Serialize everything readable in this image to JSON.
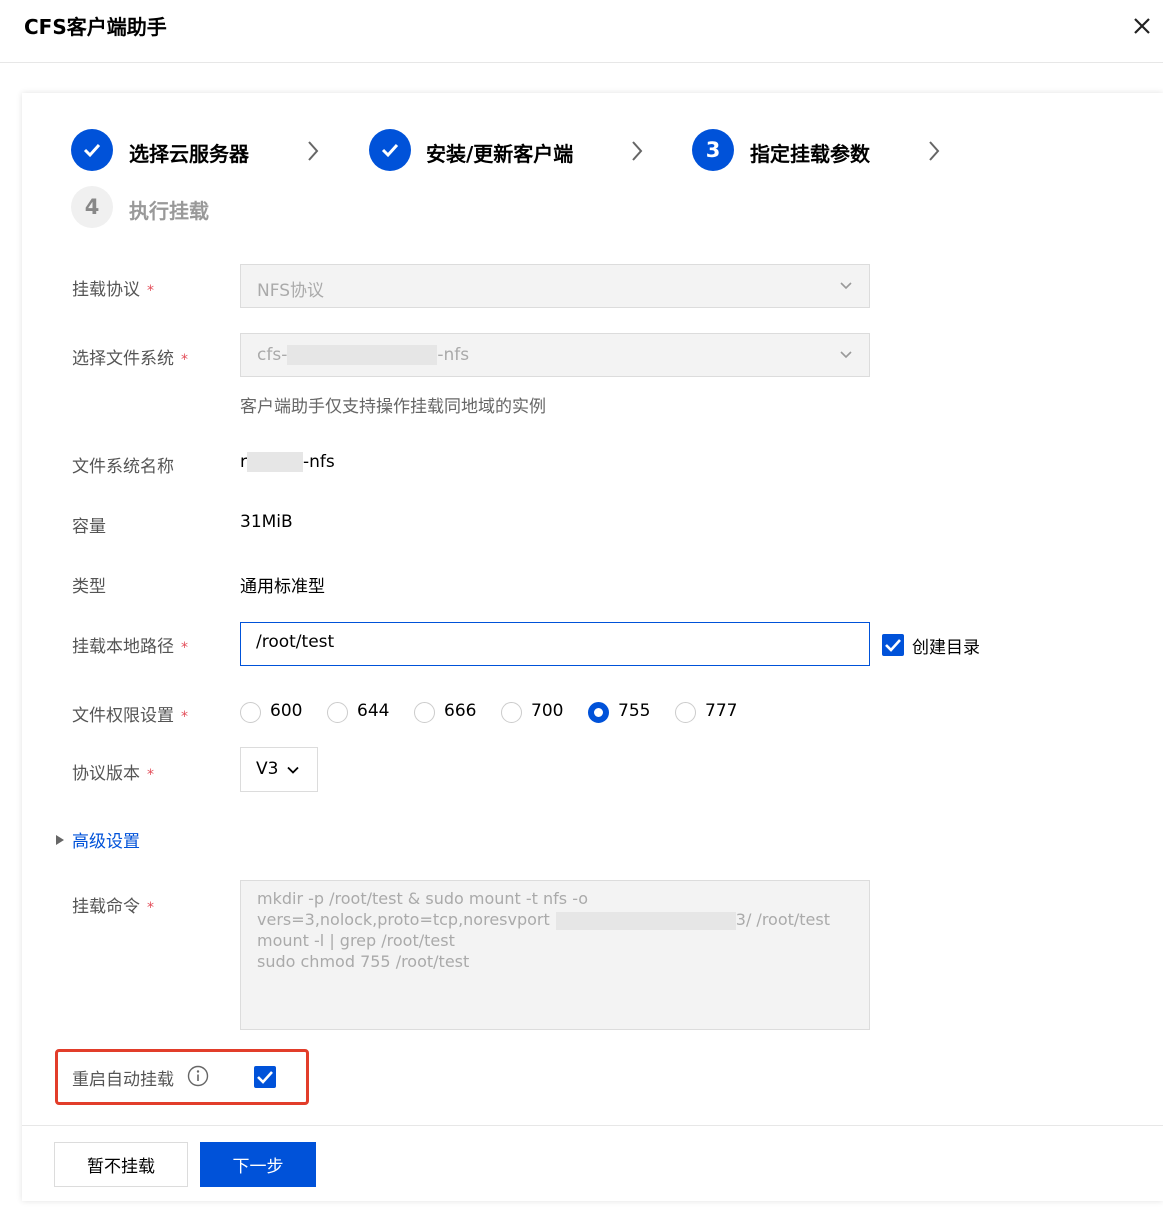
{
  "dialog": {
    "title": "CFS客户端助手"
  },
  "steps": [
    {
      "label": "选择云服务器",
      "state": "done"
    },
    {
      "label": "安装/更新客户端",
      "state": "done"
    },
    {
      "num": "3",
      "label": "指定挂载参数",
      "state": "active"
    },
    {
      "num": "4",
      "label": "执行挂载",
      "state": "wait"
    }
  ],
  "form": {
    "required_mark": "*",
    "protocol": {
      "label": "挂载协议",
      "value": "NFS协议"
    },
    "filesystem": {
      "label": "选择文件系统",
      "value_prefix": "cfs-",
      "value_suffix": "-nfs",
      "hint": "客户端助手仅支持操作挂载同地域的实例"
    },
    "fs_name": {
      "label": "文件系统名称",
      "prefix": "r",
      "suffix": "-nfs"
    },
    "capacity": {
      "label": "容量",
      "value": "31MiB"
    },
    "type": {
      "label": "类型",
      "value": "通用标准型"
    },
    "local_path": {
      "label": "挂载本地路径",
      "value": "/root/test",
      "create_dir": {
        "label": "创建目录",
        "checked": true
      }
    },
    "permission": {
      "label": "文件权限设置",
      "options": [
        "600",
        "644",
        "666",
        "700",
        "755",
        "777"
      ],
      "selected": "755"
    },
    "version": {
      "label": "协议版本",
      "value": "V3"
    },
    "advanced": {
      "label": "高级设置"
    },
    "command": {
      "label": "挂载命令",
      "line1": "mkdir -p /root/test & sudo mount -t nfs -o",
      "line2_prefix": "vers=3,nolock,proto=tcp,noresvport",
      "line2_suffix": "3/ /root/test",
      "line3": "mount -l | grep /root/test",
      "line4": "sudo chmod 755 /root/test"
    },
    "auto_mount": {
      "label": "重启自动挂载",
      "checked": true
    }
  },
  "footer": {
    "skip_label": "暂不挂载",
    "next_label": "下一步"
  },
  "colors": {
    "primary": "#0052d9",
    "required": "#e34d59",
    "highlight": "#e23d2a"
  },
  "icons": [
    "close-icon",
    "check-icon",
    "chevron-right-icon",
    "chevron-down-icon",
    "caret-right-icon",
    "info-icon"
  ]
}
